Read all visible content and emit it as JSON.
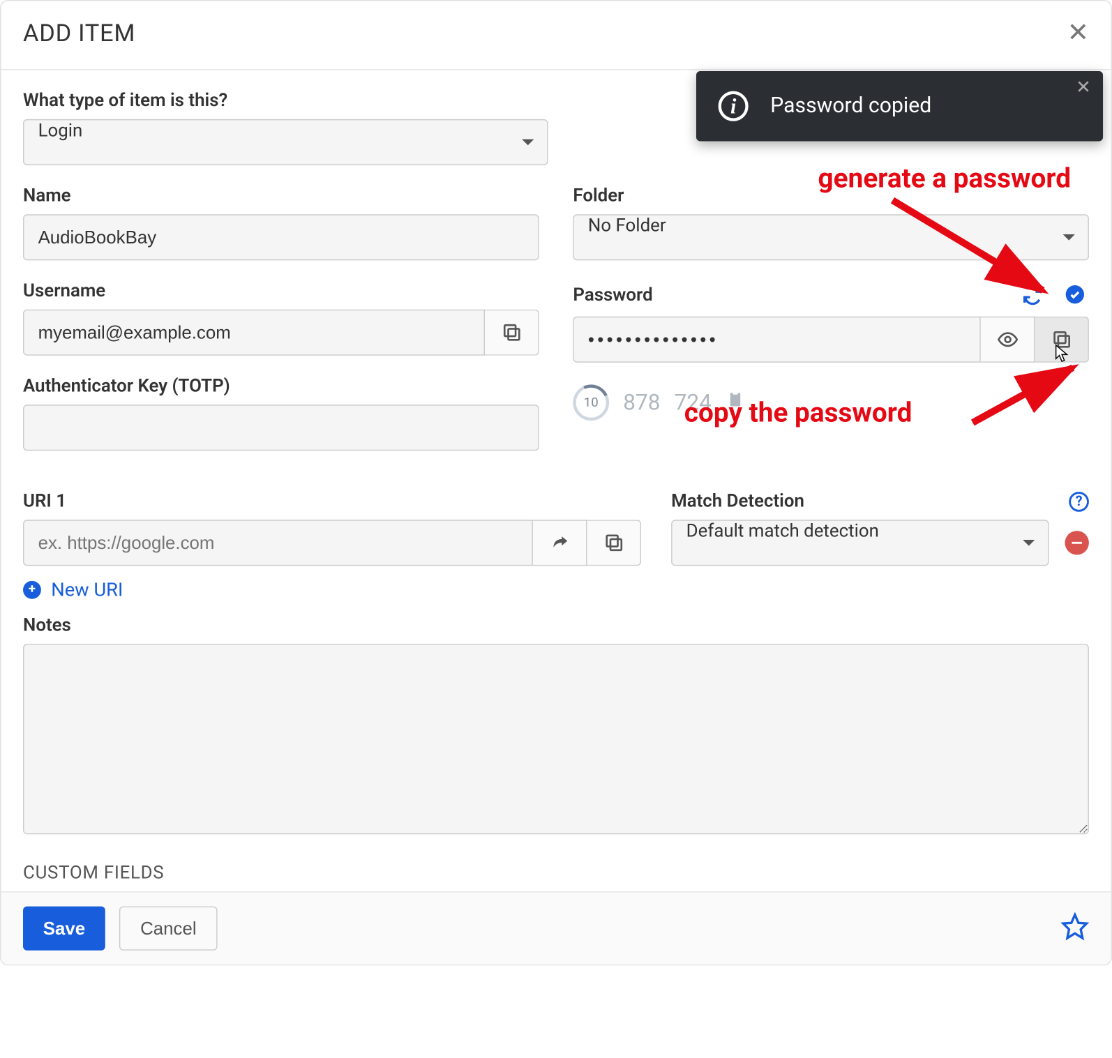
{
  "header": {
    "title": "ADD ITEM"
  },
  "toast": {
    "message": "Password copied"
  },
  "annotations": {
    "generate": "generate a password",
    "copy": "copy the password"
  },
  "item_type": {
    "label": "What type of item is this?",
    "value": "Login"
  },
  "name": {
    "label": "Name",
    "value": "AudioBookBay"
  },
  "folder": {
    "label": "Folder",
    "value": "No Folder"
  },
  "username": {
    "label": "Username",
    "value": "myemail@example.com"
  },
  "password": {
    "label": "Password",
    "masked": "••••••••••••••"
  },
  "totp": {
    "label": "Authenticator Key (TOTP)",
    "value": "",
    "countdown": "10",
    "code_a": "878",
    "code_b": "724"
  },
  "uri": {
    "label": "URI 1",
    "placeholder": "ex. https://google.com",
    "new_label": "New URI"
  },
  "match": {
    "label": "Match Detection",
    "value": "Default match detection"
  },
  "notes": {
    "label": "Notes"
  },
  "custom_fields": {
    "title": "CUSTOM FIELDS"
  },
  "footer": {
    "save": "Save",
    "cancel": "Cancel"
  }
}
